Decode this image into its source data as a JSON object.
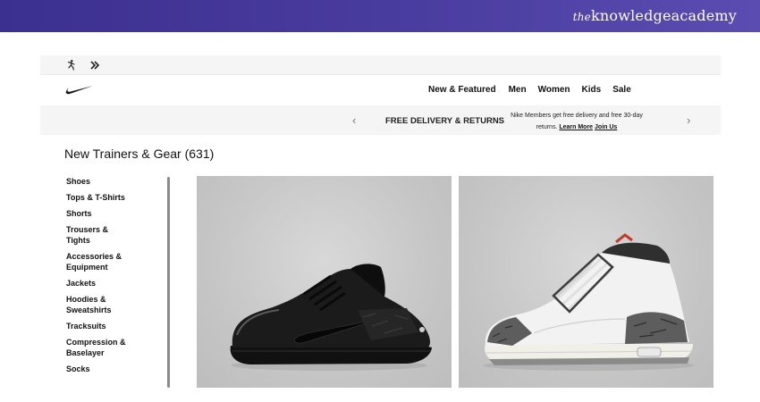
{
  "branding": {
    "prefix": "the",
    "name": "knowledgeacademy"
  },
  "utility_bar": {
    "icons": [
      "jordan-jumpman-icon",
      "converse-chevron-icon"
    ]
  },
  "header": {
    "logo": "nike-swoosh-logo",
    "nav": [
      "New & Featured",
      "Men",
      "Women",
      "Kids",
      "Sale"
    ]
  },
  "promo": {
    "title": "FREE DELIVERY & RETURNS",
    "subtitle": "Nike Members get free delivery and free 30-day returns.",
    "learn_more": "Learn More",
    "join_us": "Join Us",
    "prev_icon": "chevron-left-icon",
    "next_icon": "chevron-right-icon"
  },
  "page": {
    "title": "New Trainers & Gear (631)"
  },
  "sidebar": {
    "categories": [
      "Shoes",
      "Tops & T-Shirts",
      "Shorts",
      "Trousers & Tights",
      "Accessories & Equipment",
      "Jackets",
      "Hoodies & Sweatshirts",
      "Tracksuits",
      "Compression & Baselayer",
      "Socks"
    ]
  },
  "products": [
    {
      "image": "black-low-top-sneaker",
      "colors": {
        "main": "#1a1a1a"
      }
    },
    {
      "image": "white-cement-high-top-sneaker",
      "colors": {
        "main": "#f2f2f2",
        "accent": "#555555"
      }
    }
  ],
  "colors": {
    "brand_bar": "#3b2f8f",
    "promo_bg": "#f5f5f5",
    "card_bg": "#c8c8c8"
  }
}
